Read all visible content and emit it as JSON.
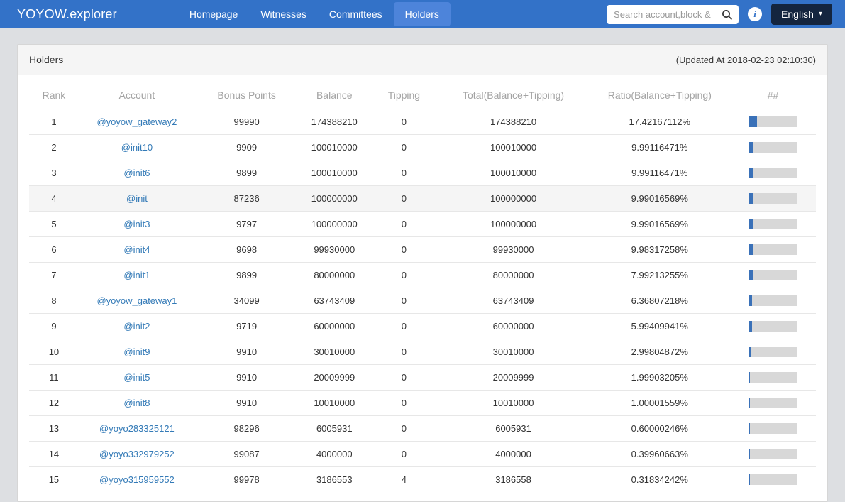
{
  "navbar": {
    "brand": "YOYOW.explorer",
    "items": [
      {
        "label": "Homepage",
        "active": false
      },
      {
        "label": "Witnesses",
        "active": false
      },
      {
        "label": "Committees",
        "active": false
      },
      {
        "label": "Holders",
        "active": true
      }
    ],
    "search_placeholder": "Search account,block &",
    "info_glyph": "i",
    "language_label": "English",
    "caret_glyph": "▾"
  },
  "panel": {
    "title": "Holders",
    "updated_at": "(Updated At 2018-02-23 02:10:30)"
  },
  "table": {
    "columns": [
      "Rank",
      "Account",
      "Bonus Points",
      "Balance",
      "Tipping",
      "Total(Balance+Tipping)",
      "Ratio(Balance+Tipping)",
      "##"
    ],
    "rows": [
      {
        "rank": "1",
        "account": "@yoyow_gateway2",
        "bonus_points": "99990",
        "balance": "174388210",
        "tipping": "0",
        "total": "174388210",
        "ratio": "17.42167112%",
        "ratio_pct": 17.42167112,
        "highlighted": false
      },
      {
        "rank": "2",
        "account": "@init10",
        "bonus_points": "9909",
        "balance": "100010000",
        "tipping": "0",
        "total": "100010000",
        "ratio": "9.99116471%",
        "ratio_pct": 9.99116471,
        "highlighted": false
      },
      {
        "rank": "3",
        "account": "@init6",
        "bonus_points": "9899",
        "balance": "100010000",
        "tipping": "0",
        "total": "100010000",
        "ratio": "9.99116471%",
        "ratio_pct": 9.99116471,
        "highlighted": false
      },
      {
        "rank": "4",
        "account": "@init",
        "bonus_points": "87236",
        "balance": "100000000",
        "tipping": "0",
        "total": "100000000",
        "ratio": "9.99016569%",
        "ratio_pct": 9.99016569,
        "highlighted": true
      },
      {
        "rank": "5",
        "account": "@init3",
        "bonus_points": "9797",
        "balance": "100000000",
        "tipping": "0",
        "total": "100000000",
        "ratio": "9.99016569%",
        "ratio_pct": 9.99016569,
        "highlighted": false
      },
      {
        "rank": "6",
        "account": "@init4",
        "bonus_points": "9698",
        "balance": "99930000",
        "tipping": "0",
        "total": "99930000",
        "ratio": "9.98317258%",
        "ratio_pct": 9.98317258,
        "highlighted": false
      },
      {
        "rank": "7",
        "account": "@init1",
        "bonus_points": "9899",
        "balance": "80000000",
        "tipping": "0",
        "total": "80000000",
        "ratio": "7.99213255%",
        "ratio_pct": 7.99213255,
        "highlighted": false
      },
      {
        "rank": "8",
        "account": "@yoyow_gateway1",
        "bonus_points": "34099",
        "balance": "63743409",
        "tipping": "0",
        "total": "63743409",
        "ratio": "6.36807218%",
        "ratio_pct": 6.36807218,
        "highlighted": false
      },
      {
        "rank": "9",
        "account": "@init2",
        "bonus_points": "9719",
        "balance": "60000000",
        "tipping": "0",
        "total": "60000000",
        "ratio": "5.99409941%",
        "ratio_pct": 5.99409941,
        "highlighted": false
      },
      {
        "rank": "10",
        "account": "@init9",
        "bonus_points": "9910",
        "balance": "30010000",
        "tipping": "0",
        "total": "30010000",
        "ratio": "2.99804872%",
        "ratio_pct": 2.99804872,
        "highlighted": false
      },
      {
        "rank": "11",
        "account": "@init5",
        "bonus_points": "9910",
        "balance": "20009999",
        "tipping": "0",
        "total": "20009999",
        "ratio": "1.99903205%",
        "ratio_pct": 1.99903205,
        "highlighted": false
      },
      {
        "rank": "12",
        "account": "@init8",
        "bonus_points": "9910",
        "balance": "10010000",
        "tipping": "0",
        "total": "10010000",
        "ratio": "1.00001559%",
        "ratio_pct": 1.00001559,
        "highlighted": false
      },
      {
        "rank": "13",
        "account": "@yoyo283325121",
        "bonus_points": "98296",
        "balance": "6005931",
        "tipping": "0",
        "total": "6005931",
        "ratio": "0.60000246%",
        "ratio_pct": 0.60000246,
        "highlighted": false
      },
      {
        "rank": "14",
        "account": "@yoyo332979252",
        "bonus_points": "99087",
        "balance": "4000000",
        "tipping": "0",
        "total": "4000000",
        "ratio": "0.39960663%",
        "ratio_pct": 0.39960663,
        "highlighted": false
      },
      {
        "rank": "15",
        "account": "@yoyo315959552",
        "bonus_points": "99978",
        "balance": "3186553",
        "tipping": "4",
        "total": "3186558",
        "ratio": "0.31834242%",
        "ratio_pct": 0.31834242,
        "highlighted": false
      }
    ]
  },
  "colors": {
    "navbar_bg": "#3372c8",
    "navbar_active_bg": "#4d84da",
    "language_button_bg": "#14253f",
    "link": "#337ab7",
    "bar_fill": "#3a71b8",
    "bar_track": "#d8d8d8",
    "page_bg": "#dddfe2",
    "panel_header_bg": "#f5f5f5"
  }
}
